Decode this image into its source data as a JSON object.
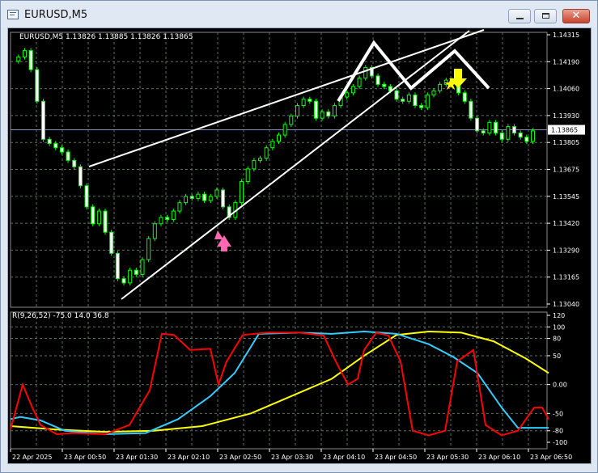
{
  "window": {
    "title": "EURUSD,M5",
    "minimize_icon": "minimize-icon",
    "maximize_icon": "maximize-icon",
    "close_icon": "close-icon",
    "close_glyph": "✕"
  },
  "chart": {
    "symbol_header": "EURUSD,M5  1.13826 1.13885 1.13826 1.13865",
    "current_price": "1.13865",
    "price_axis": [
      "1.14315",
      "1.14190",
      "1.14060",
      "1.13930",
      "1.13805",
      "1.13675",
      "1.13545",
      "1.13420",
      "1.13290",
      "1.13165",
      "1.13040"
    ],
    "time_axis": [
      "22 Apr 2025",
      "23 Apr 00:50",
      "23 Apr 01:30",
      "23 Apr 02:10",
      "23 Apr 02:50",
      "23 Apr 03:30",
      "23 Apr 04:10",
      "23 Apr 04:50",
      "23 Apr 05:30",
      "23 Apr 06:10",
      "23 Apr 06:50"
    ],
    "indicator_label": "R(9,26,52) -75.0 14.0 36.8",
    "indicator_axis": [
      "120",
      "100",
      "80",
      "50",
      "0.00",
      "-50",
      "-80",
      "-100"
    ],
    "colors": {
      "background": "#000000",
      "grid": "#5f6f5f",
      "bull_candle": "#000000",
      "bear_candle": "#ffffff",
      "candle_outline": "#00ff00",
      "trendline": "#ffffff",
      "buy_arrow": "#ff69b4",
      "sell_arrow": "#ffff00",
      "fast_line": "#ff0000",
      "mid_line": "#33ccff",
      "slow_line": "#ffff00"
    }
  }
}
